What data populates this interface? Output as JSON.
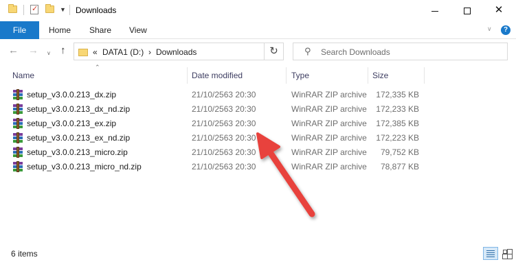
{
  "window": {
    "title": "Downloads",
    "controls": {
      "minimize": "minimize",
      "maximize": "maximize",
      "close": "✕"
    }
  },
  "ribbon": {
    "tabs": [
      "File",
      "Home",
      "Share",
      "View"
    ],
    "help_label": "?"
  },
  "address_bar": {
    "overflow": "«",
    "segments": [
      "DATA1 (D:)",
      "Downloads"
    ],
    "separator": "›"
  },
  "search": {
    "placeholder": "Search Downloads"
  },
  "columns": [
    "Name",
    "Date modified",
    "Type",
    "Size"
  ],
  "files": [
    {
      "name": "setup_v3.0.0.213_dx.zip",
      "date": "21/10/2563 20:30",
      "type": "WinRAR ZIP archive",
      "size": "172,335 KB"
    },
    {
      "name": "setup_v3.0.0.213_dx_nd.zip",
      "date": "21/10/2563 20:30",
      "type": "WinRAR ZIP archive",
      "size": "172,233 KB"
    },
    {
      "name": "setup_v3.0.0.213_ex.zip",
      "date": "21/10/2563 20:30",
      "type": "WinRAR ZIP archive",
      "size": "172,385 KB"
    },
    {
      "name": "setup_v3.0.0.213_ex_nd.zip",
      "date": "21/10/2563 20:30",
      "type": "WinRAR ZIP archive",
      "size": "172,223 KB"
    },
    {
      "name": "setup_v3.0.0.213_micro.zip",
      "date": "21/10/2563 20:30",
      "type": "WinRAR ZIP archive",
      "size": "79,752 KB"
    },
    {
      "name": "setup_v3.0.0.213_micro_nd.zip",
      "date": "21/10/2563 20:30",
      "type": "WinRAR ZIP archive",
      "size": "78,877 KB"
    }
  ],
  "status": {
    "item_count": "6 items"
  },
  "icons": {
    "file": "winrar-zip-icon",
    "folder": "folder-icon",
    "annotation": "red-arrow"
  },
  "colors": {
    "accent": "#1979ca",
    "annotation": "#e8433c"
  }
}
